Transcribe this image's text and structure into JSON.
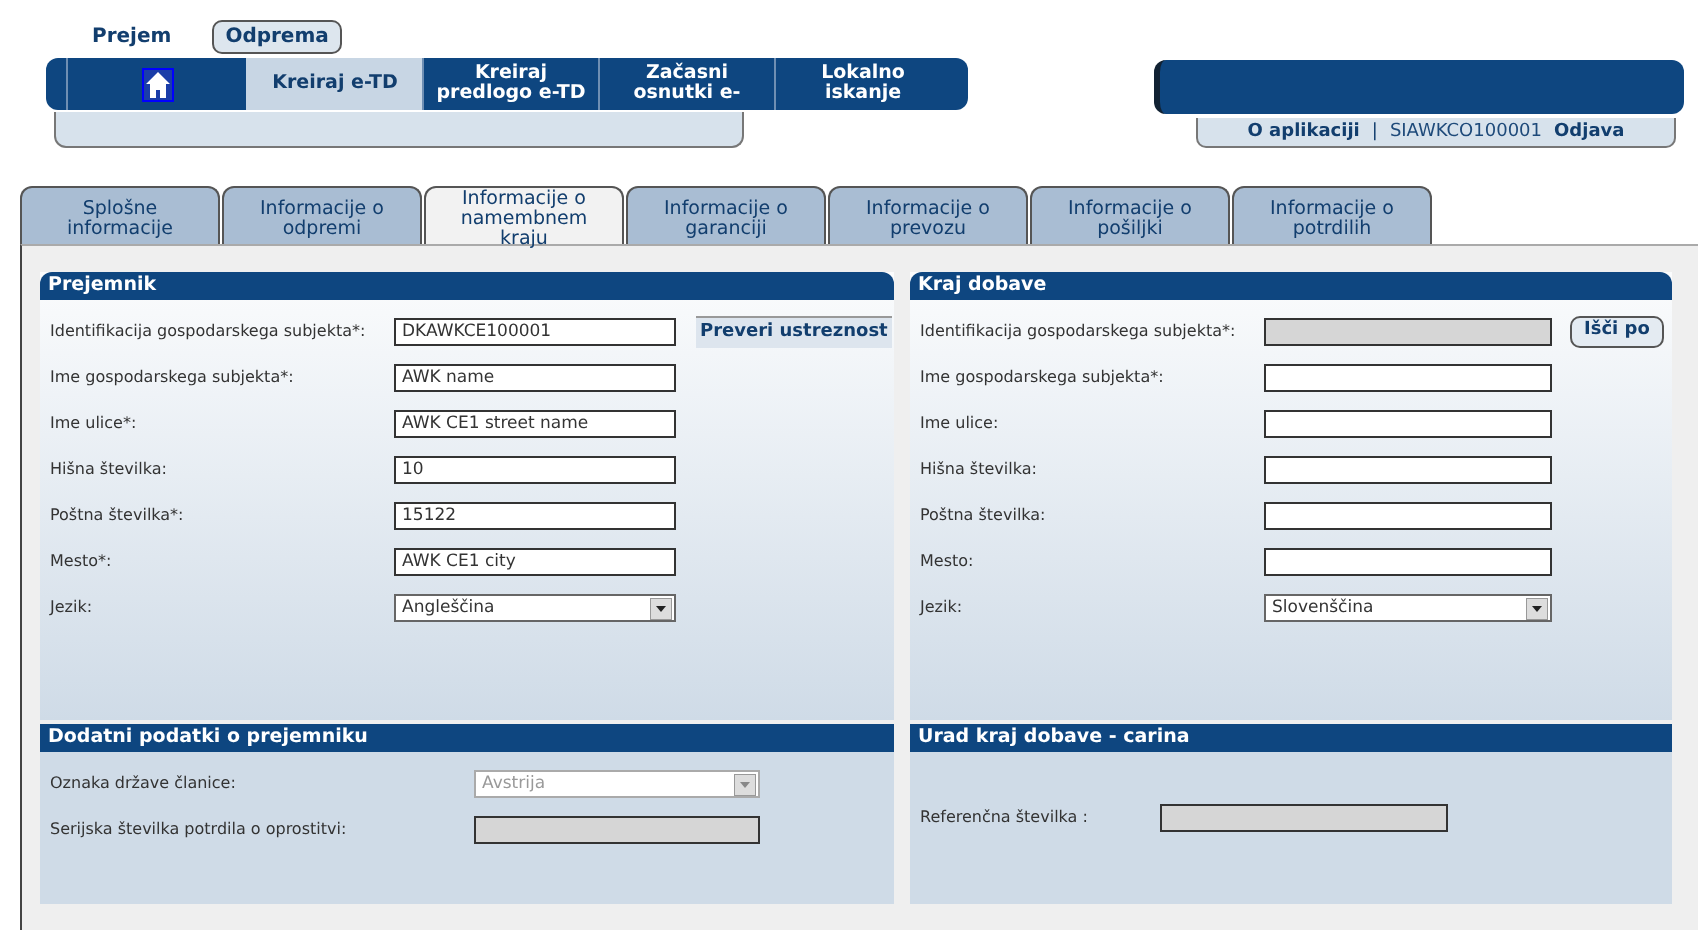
{
  "mode_tabs": [
    {
      "label": "Prejem",
      "selected": false
    },
    {
      "label": "Odprema",
      "selected": true
    }
  ],
  "nav": [
    {
      "kind": "home",
      "selected": false
    },
    {
      "kind": "text",
      "label": "Kreiraj e-TD",
      "selected": true
    },
    {
      "kind": "text",
      "label": "Kreiraj predlogo e-TD",
      "selected": false
    },
    {
      "kind": "text",
      "label": "Začasni osnutki e-",
      "selected": false
    },
    {
      "kind": "text",
      "label": "Lokalno iskanje",
      "selected": false
    }
  ],
  "user_bar": {
    "about": "O aplikaciji",
    "separator": "|",
    "user": "SIAWKCO100001",
    "logout": "Odjava"
  },
  "tabs": [
    {
      "label": "Splošne informacije",
      "selected": false
    },
    {
      "label": "Informacije o odpremi",
      "selected": false
    },
    {
      "label": "Informacije o namembnem kraju",
      "selected": true
    },
    {
      "label": "Informacije o garanciji",
      "selected": false
    },
    {
      "label": "Informacije o prevozu",
      "selected": false
    },
    {
      "label": "Informacije o pošiljki",
      "selected": false
    },
    {
      "label": "Informacije o potrdilih",
      "selected": false
    }
  ],
  "upper_sections": [
    {
      "title": "Prejemnik",
      "action": {
        "label": "Preveri ustreznost",
        "kind": "flat"
      },
      "fields": [
        {
          "label": "Identifikacija gospodarskega subjekta*:",
          "kind": "text",
          "value": "DKAWKCE100001",
          "disabled": false
        },
        {
          "label": "Ime gospodarskega subjekta*:",
          "kind": "text",
          "value": "AWK name",
          "disabled": false
        },
        {
          "label": "Ime ulice*:",
          "kind": "text",
          "value": "AWK CE1 street name",
          "disabled": false
        },
        {
          "label": "Hišna številka:",
          "kind": "text",
          "value": "10",
          "disabled": false
        },
        {
          "label": "Poštna številka*:",
          "kind": "text",
          "value": "15122",
          "disabled": false
        },
        {
          "label": "Mesto*:",
          "kind": "text",
          "value": "AWK CE1 city",
          "disabled": false
        },
        {
          "label": "Jezik:",
          "kind": "select",
          "value": "Angleščina",
          "disabled": false
        }
      ]
    },
    {
      "title": "Kraj dobave",
      "action": {
        "label": "Išči po",
        "kind": "rounded"
      },
      "fields": [
        {
          "label": "Identifikacija gospodarskega subjekta*:",
          "kind": "text",
          "disabled": true
        },
        {
          "label": "Ime gospodarskega subjekta*:",
          "kind": "text",
          "disabled": false
        },
        {
          "label": "Ime ulice:",
          "kind": "text",
          "disabled": false
        },
        {
          "label": "Hišna številka:",
          "kind": "text",
          "disabled": false
        },
        {
          "label": "Poštna številka:",
          "kind": "text",
          "disabled": false
        },
        {
          "label": "Mesto:",
          "kind": "text",
          "disabled": false
        },
        {
          "label": "Jezik:",
          "kind": "select",
          "value": "Slovenščina",
          "disabled": false
        }
      ]
    }
  ],
  "lower_sections": [
    {
      "title": "Dodatni podatki o prejemniku",
      "fields": [
        {
          "label": "Oznaka države članice:",
          "kind": "select",
          "value": "Avstrija",
          "disabled": true
        },
        {
          "label": "Serijska številka potrdila o oprostitvi:",
          "kind": "text",
          "disabled": true
        }
      ]
    },
    {
      "title": "Urad kraj dobave - carina",
      "fields": [
        {
          "label": "Referenčna številka :",
          "kind": "text",
          "disabled": true
        }
      ]
    }
  ]
}
